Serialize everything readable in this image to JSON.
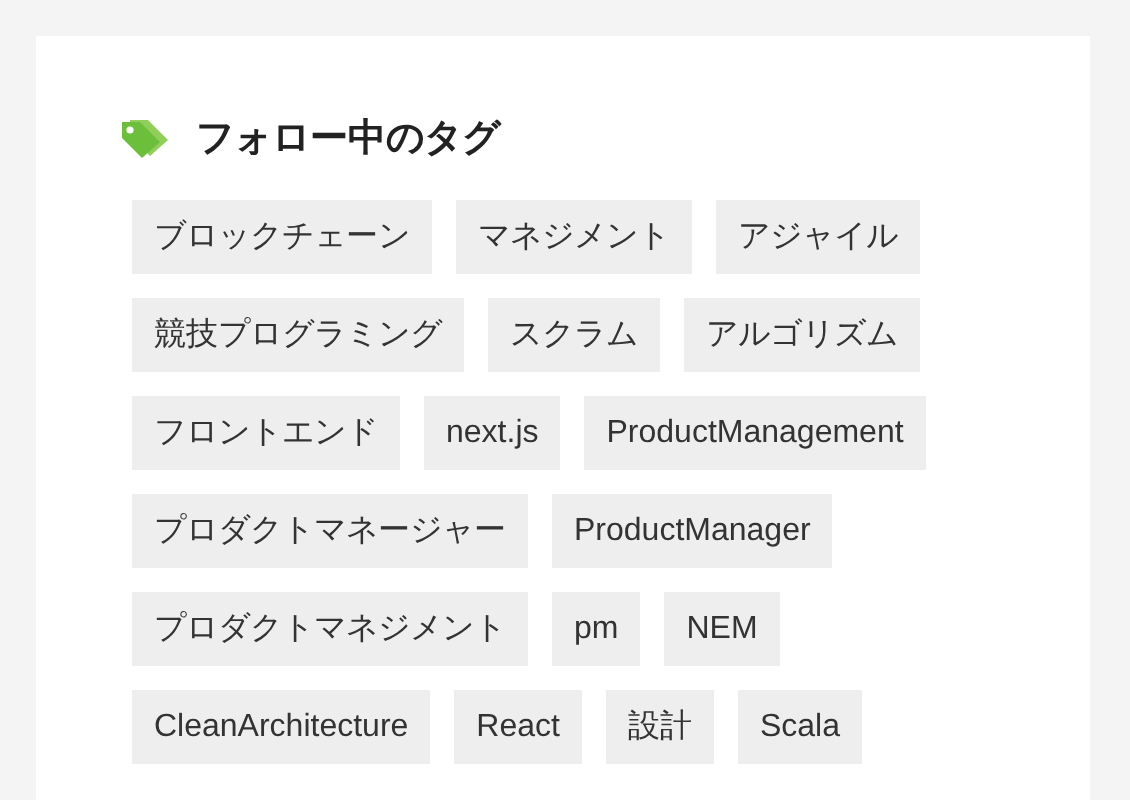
{
  "card": {
    "title": "フォロー中のタグ",
    "tags": [
      {
        "label": "ブロックチェーン"
      },
      {
        "label": "マネジメント"
      },
      {
        "label": "アジャイル"
      },
      {
        "label": "競技プログラミング"
      },
      {
        "label": "スクラム"
      },
      {
        "label": "アルゴリズム"
      },
      {
        "label": "フロントエンド"
      },
      {
        "label": "next.js"
      },
      {
        "label": "ProductManagement"
      },
      {
        "label": "プロダクトマネージャー"
      },
      {
        "label": "ProductManager"
      },
      {
        "label": "プロダクトマネジメント"
      },
      {
        "label": "pm"
      },
      {
        "label": "NEM"
      },
      {
        "label": "CleanArchitecture"
      },
      {
        "label": "React"
      },
      {
        "label": "設計"
      },
      {
        "label": "Scala"
      }
    ]
  }
}
